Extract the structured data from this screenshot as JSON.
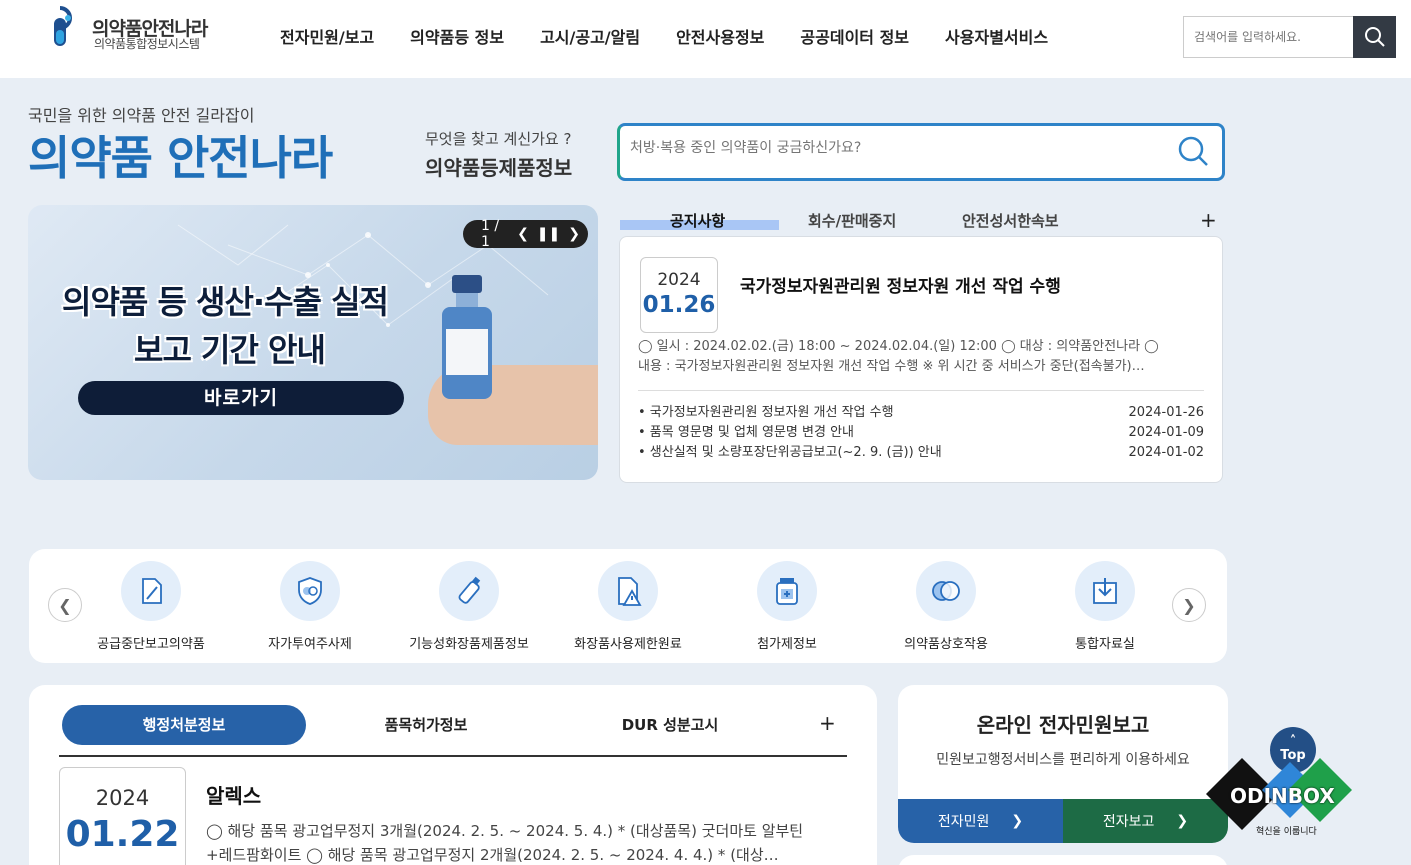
{
  "header": {
    "logo_title": "의약품안전나라",
    "logo_sub": "의약품통합정보시스템",
    "nav": [
      "전자민원/보고",
      "의약품등 정보",
      "고시/공고/알림",
      "안전사용정보",
      "공공데이터 정보",
      "사용자별서비스"
    ],
    "search_placeholder": "검색어를 입력하세요."
  },
  "hero": {
    "subtitle": "국민을 위한 의약품 안전 길라잡이",
    "title": "의약품 안전나라",
    "ask": "무엇을 찾고 계신가요 ?",
    "ask_title": "의약품등제품정보",
    "search_placeholder": "처방·복용 중인 의약품이 궁금하신가요?"
  },
  "banner": {
    "line1": "의약품 등 생산·수출 실적",
    "line2": "보고 기간 안내",
    "button": "바로가기",
    "counter": "1 / 1"
  },
  "notice": {
    "tabs": [
      "공지사항",
      "회수/판매중지",
      "안전성서한속보"
    ],
    "featured": {
      "year": "2024",
      "date": "01.26",
      "title": "국가정보자원관리원 정보자원 개선 작업 수행",
      "desc": "◯ 일시 : 2024.02.02.(금) 18:00 ~ 2024.02.04.(일) 12:00 ◯ 대상 : 의약품안전나라 ◯ 내용 : 국가정보자원관리원 정보자원 개선 작업 수행 ※  위 시간 중 서비스가 중단(접속불가)…"
    },
    "items": [
      {
        "title": "• 국가정보자원관리원 정보자원 개선 작업 수행",
        "date": "2024-01-26"
      },
      {
        "title": "• 품목 영문명 및 업체 영문명 변경 안내",
        "date": "2024-01-09"
      },
      {
        "title": "• 생산실적 및 소량포장단위공급보고(~2. 9. (금)) 안내",
        "date": "2024-01-02"
      }
    ]
  },
  "quick": {
    "items": [
      "공급중단보고의약품",
      "자가투여주사제",
      "기능성화장품제품정보",
      "화장품사용제한원료",
      "첨가제정보",
      "의약품상호작용",
      "통합자료실"
    ],
    "icons": [
      "document-pen-icon",
      "shield-pill-icon",
      "cosmetic-bottle-icon",
      "warning-document-icon",
      "medicine-jar-icon",
      "capsule-icon",
      "download-icon"
    ]
  },
  "admin": {
    "tabs": [
      "행정처분정보",
      "품목허가정보",
      "DUR 성분고시"
    ],
    "year": "2024",
    "date": "01.22",
    "title": "알렉스",
    "desc": "◯ 해당 품목 광고업무정지 3개월(2024. 2. 5. ~ 2024. 5. 4.) * (대상품목) 굿더마토 알부틴+레드팜화이트 ◯ 해당 품목 광고업무정지 2개월(2024. 2. 5. ~ 2024. 4. 4.) * (대상…"
  },
  "civil": {
    "title": "온라인 전자민원보고",
    "sub": "민원보고행정서비스를 편리하게 이용하세요",
    "btn1": "전자민원",
    "btn2": "전자보고",
    "btn1_color": "#2762a8",
    "btn2_color": "#1d6b45"
  },
  "floating": {
    "top": "Top",
    "odin": "ODINBOX",
    "odin_sub": "혁신을 이룹니다"
  }
}
